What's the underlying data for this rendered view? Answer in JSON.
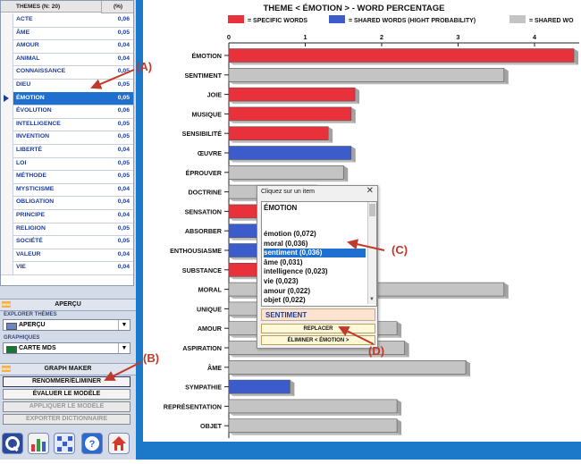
{
  "themes_table": {
    "header_name": "THEMES (N: 20)",
    "header_pct": "(%)",
    "rows": [
      {
        "name": "ACTE",
        "pct": "0,06"
      },
      {
        "name": "ÂME",
        "pct": "0,05"
      },
      {
        "name": "AMOUR",
        "pct": "0,04"
      },
      {
        "name": "ANIMAL",
        "pct": "0,04"
      },
      {
        "name": "CONNAISSANCE",
        "pct": "0,05"
      },
      {
        "name": "DIEU",
        "pct": "0,05"
      },
      {
        "name": "ÉMOTION",
        "pct": "0,05"
      },
      {
        "name": "ÉVOLUTION",
        "pct": "0,06"
      },
      {
        "name": "INTELLIGENCE",
        "pct": "0,05"
      },
      {
        "name": "INVENTION",
        "pct": "0,05"
      },
      {
        "name": "LIBERTÉ",
        "pct": "0,04"
      },
      {
        "name": "LOI",
        "pct": "0,05"
      },
      {
        "name": "MÉTHODE",
        "pct": "0,05"
      },
      {
        "name": "MYSTICISME",
        "pct": "0,04"
      },
      {
        "name": "OBLIGATION",
        "pct": "0,04"
      },
      {
        "name": "PRINCIPE",
        "pct": "0,04"
      },
      {
        "name": "RELIGION",
        "pct": "0,05"
      },
      {
        "name": "SOCIÉTÉ",
        "pct": "0,05"
      },
      {
        "name": "VALEUR",
        "pct": "0,04"
      },
      {
        "name": "VIE",
        "pct": "0,04"
      }
    ],
    "selected_row": "ÉMOTION"
  },
  "panel": {
    "apercu_title": "APERÇU",
    "explorer_label": "EXPLORER THÈMES",
    "explorer_value": "APERÇU",
    "graph_label": "GRAPHIQUES",
    "graph_value": "CARTE MDS",
    "graph_maker_title": "GRAPH MAKER",
    "new_tag": "NEW",
    "buttons": {
      "rename": "RENOMMER/ÉLIMINER",
      "evaluate": "ÉVALUER LE MODÈLE",
      "apply": "APPLIQUER LE MODÈLE",
      "export": "EXPORTER DICTIONNAIRE"
    },
    "toolbar_icons": [
      "q-logo-icon",
      "bar-chart-icon",
      "grid-icon",
      "help-icon",
      "home-icon"
    ],
    "colors": {
      "explorer_swatch": "#6a86c9",
      "graph_swatch": "#127a2c"
    }
  },
  "chart_data": {
    "type": "bar",
    "title": "THEME < ÉMOTION > - WORD PERCENTAGE",
    "legend": [
      {
        "label": "= SPECIFIC WORDS",
        "color": "#e8313a"
      },
      {
        "label": "= SHARED WORDS (HIGHT PROBABILITY)",
        "color": "#3d5ccc"
      },
      {
        "label": "= SHARED WO",
        "color": "#c4c4c4"
      }
    ],
    "x_ticks": [
      "0",
      "1",
      "2",
      "3",
      "4"
    ],
    "xlim": [
      0,
      4.6
    ],
    "categories": [
      "ÉMOTION",
      "SENTIMENT",
      "JOIE",
      "MUSIQUE",
      "SENSIBILITÉ",
      "ŒUVRE",
      "ÉPROUVER",
      "DOCTRINE",
      "SENSATION",
      "ABSORBER",
      "ENTHOUSIASME",
      "SUBSTANCE",
      "MORAL",
      "UNIQUE",
      "AMOUR",
      "ASPIRATION",
      "ÂME",
      "SYMPATHIE",
      "REPRÉSENTATION",
      "OBJET"
    ],
    "values": [
      4.6,
      3.6,
      1.65,
      1.6,
      1.3,
      1.6,
      1.5,
      1.15,
      1.1,
      1.1,
      1.1,
      1.1,
      3.6,
      1.7,
      2.2,
      2.3,
      3.1,
      0.8,
      2.2,
      2.2
    ],
    "groups": [
      "specific",
      "shared_grey",
      "specific",
      "specific",
      "specific",
      "shared_blue",
      "shared_grey",
      "shared_grey",
      "specific",
      "shared_blue",
      "shared_blue",
      "specific",
      "shared_grey",
      "shared_grey",
      "shared_grey",
      "shared_grey",
      "shared_grey",
      "shared_blue",
      "shared_grey",
      "shared_grey"
    ],
    "group_colors": {
      "specific": "#e8313a",
      "shared_blue": "#3d5ccc",
      "shared_grey": "#c4c4c4"
    }
  },
  "popup": {
    "title": "Cliquez sur un item",
    "close": "✕",
    "list_header": "ÉMOTION",
    "items": [
      "émotion (0,072)",
      "moral (0,036)",
      "sentiment (0,036)",
      "âme (0,031)",
      "intelligence (0,023)",
      "vie (0,023)",
      "amour (0,022)",
      "objet (0,022)"
    ],
    "selected_item": "sentiment (0,036)",
    "field_value": "SENTIMENT",
    "replace_button": "REPLACER",
    "eliminate_button": "ÉLIMINER < ÉMOTION >"
  },
  "annotations": {
    "a": "(A)",
    "b": "(B)",
    "c": "(C)",
    "d": "(D)",
    "color": "#c0392b"
  }
}
